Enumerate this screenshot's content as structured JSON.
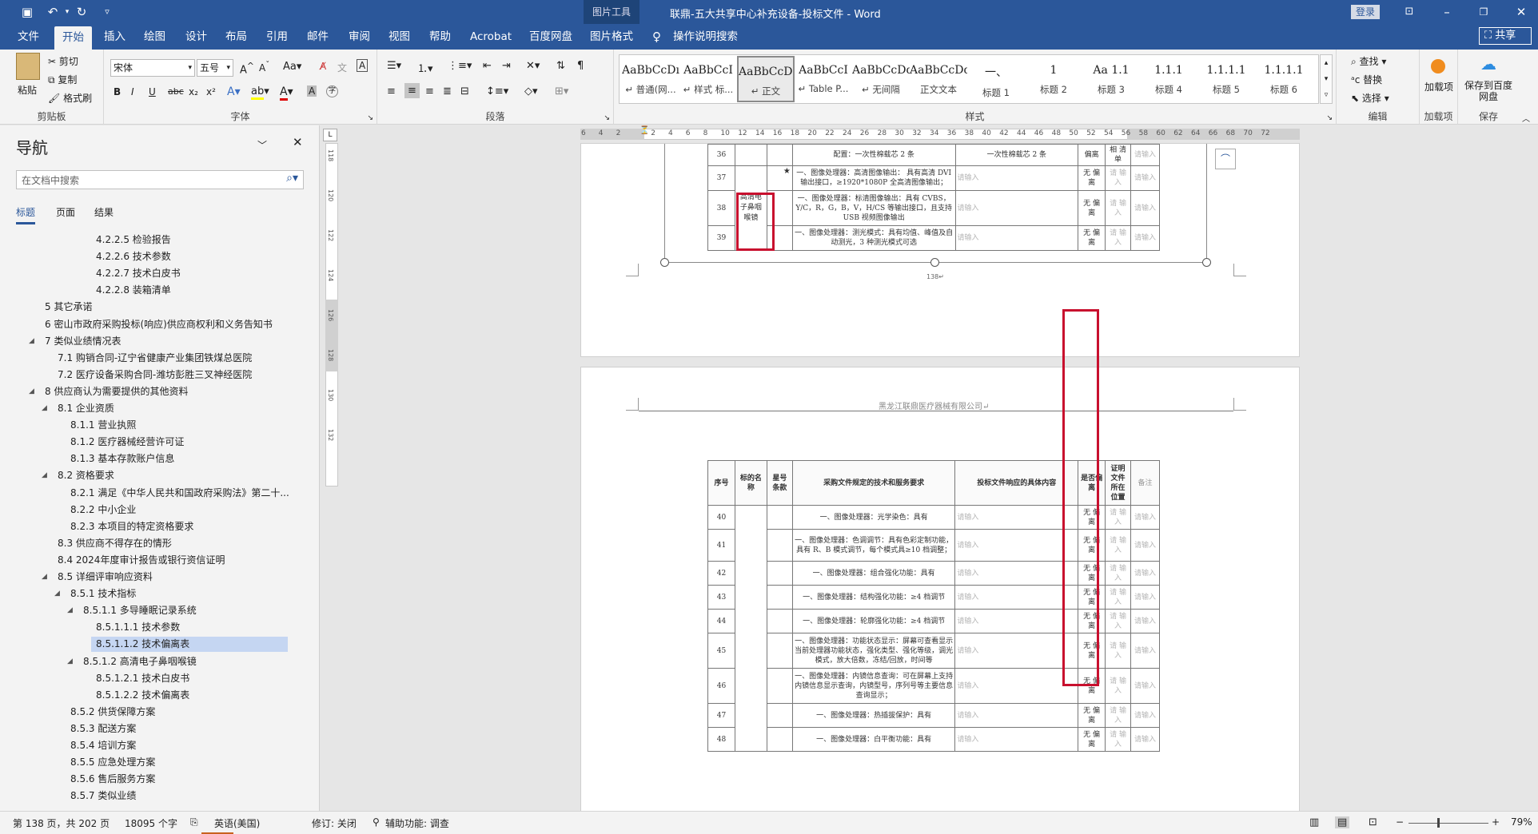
{
  "app": {
    "title": "联鼎-五大共享中心补充设备-投标文件 - Word",
    "context_tool": "图片工具",
    "login": "登录"
  },
  "menu": {
    "items": [
      "文件",
      "开始",
      "插入",
      "绘图",
      "设计",
      "布局",
      "引用",
      "邮件",
      "审阅",
      "视图",
      "帮助",
      "Acrobat",
      "百度网盘",
      "图片格式"
    ],
    "tell": "操作说明搜索",
    "share": "共享"
  },
  "ribbon": {
    "clipboard": {
      "paste": "粘贴",
      "cut": "剪切",
      "copy": "复制",
      "format_painter": "格式刷",
      "label": "剪贴板"
    },
    "font": {
      "name": "宋体",
      "size": "五号",
      "label": "字体",
      "bold": "B",
      "italic": "I",
      "underline": "U",
      "strike": "abc",
      "sub": "x₂",
      "sup": "x²"
    },
    "paragraph": {
      "label": "段落"
    },
    "styles": {
      "label": "样式",
      "cards": [
        {
          "preview": "AaBbCcDı",
          "name": "↵ 普通(网..."
        },
        {
          "preview": "AaBbCcI",
          "name": "↵ 样式 标..."
        },
        {
          "preview": "AaBbCcDdI",
          "name": "↵ 正文"
        },
        {
          "preview": "AaBbCcI",
          "name": "↵ Table P..."
        },
        {
          "preview": "AaBbCcDdI",
          "name": "↵ 无间隔"
        },
        {
          "preview": "AaBbCcDdI",
          "name": "正文文本"
        },
        {
          "preview": "一、",
          "name": "标题 1"
        },
        {
          "preview": "1",
          "name": "标题 2"
        },
        {
          "preview": "Aa 1.1",
          "name": "标题 3"
        },
        {
          "preview": "1.1.1",
          "name": "标题 4"
        },
        {
          "preview": "1.1.1.1",
          "name": "标题 5"
        },
        {
          "preview": "1.1.1.1",
          "name": "标题 6"
        }
      ]
    },
    "editing": {
      "find": "查找",
      "replace": "替换",
      "select": "选择",
      "label": "编辑"
    },
    "addins": {
      "load": "加载项",
      "label": "加载项"
    },
    "save": {
      "button": "保存到百度网盘",
      "label": "保存"
    }
  },
  "nav": {
    "title": "导航",
    "search_placeholder": "在文档中搜索",
    "tabs": [
      "标题",
      "页面",
      "结果"
    ],
    "items": [
      {
        "text": "4.2.2.5 检验报告",
        "level": 4,
        "tri": ""
      },
      {
        "text": "4.2.2.6 技术参数",
        "level": 4,
        "tri": ""
      },
      {
        "text": "4.2.2.7 技术白皮书",
        "level": 4,
        "tri": ""
      },
      {
        "text": "4.2.2.8 装箱清单",
        "level": 4,
        "tri": ""
      },
      {
        "text": "5 其它承诺",
        "level": 0,
        "tri": ""
      },
      {
        "text": "6 密山市政府采购投标(响应)供应商权利和义务告知书",
        "level": 0,
        "tri": ""
      },
      {
        "text": "7 类似业绩情况表",
        "level": 0,
        "tri": "◢"
      },
      {
        "text": "7.1 购销合同-辽宁省健康产业集团铁煤总医院",
        "level": 1,
        "tri": ""
      },
      {
        "text": "7.2 医疗设备采购合同-潍坊彭胜三叉神经医院",
        "level": 1,
        "tri": ""
      },
      {
        "text": "8 供应商认为需要提供的其他资料",
        "level": 0,
        "tri": "◢"
      },
      {
        "text": "8.1 企业资质",
        "level": 1,
        "tri": "◢"
      },
      {
        "text": "8.1.1 营业执照",
        "level": 2,
        "tri": ""
      },
      {
        "text": "8.1.2 医疗器械经营许可证",
        "level": 2,
        "tri": ""
      },
      {
        "text": "8.1.3 基本存款账户信息",
        "level": 2,
        "tri": ""
      },
      {
        "text": "8.2 资格要求",
        "level": 1,
        "tri": "◢"
      },
      {
        "text": "8.2.1 满足《中华人民共和国政府采购法》第二十...",
        "level": 2,
        "tri": ""
      },
      {
        "text": "8.2.2 中小企业",
        "level": 2,
        "tri": ""
      },
      {
        "text": "8.2.3 本项目的特定资格要求",
        "level": 2,
        "tri": ""
      },
      {
        "text": "8.3 供应商不得存在的情形",
        "level": 1,
        "tri": ""
      },
      {
        "text": "8.4 2024年度审计报告或银行资信证明",
        "level": 1,
        "tri": ""
      },
      {
        "text": "8.5 详细评审响应资料",
        "level": 1,
        "tri": "◢"
      },
      {
        "text": "8.5.1 技术指标",
        "level": 2,
        "tri": "◢"
      },
      {
        "text": "8.5.1.1 多导睡眠记录系统",
        "level": 3,
        "tri": "◢"
      },
      {
        "text": "8.5.1.1.1 技术参数",
        "level": 4,
        "tri": ""
      },
      {
        "text": "8.5.1.1.2 技术偏离表",
        "level": 4,
        "tri": "",
        "selected": true
      },
      {
        "text": "8.5.1.2 高清电子鼻咽喉镜",
        "level": 3,
        "tri": "◢"
      },
      {
        "text": "8.5.1.2.1 技术白皮书",
        "level": 4,
        "tri": ""
      },
      {
        "text": "8.5.1.2.2 技术偏离表",
        "level": 4,
        "tri": ""
      },
      {
        "text": "8.5.2 供货保障方案",
        "level": 2,
        "tri": ""
      },
      {
        "text": "8.5.3 配送方案",
        "level": 2,
        "tri": ""
      },
      {
        "text": "8.5.4 培训方案",
        "level": 2,
        "tri": ""
      },
      {
        "text": "8.5.5 应急处理方案",
        "level": 2,
        "tri": ""
      },
      {
        "text": "8.5.6 售后服务方案",
        "level": 2,
        "tri": ""
      },
      {
        "text": "8.5.7 类似业绩",
        "level": 2,
        "tri": ""
      }
    ]
  },
  "ruler": {
    "top": [
      "6",
      "4",
      "2",
      "",
      "2",
      "4",
      "6",
      "8",
      "10",
      "12",
      "14",
      "16",
      "18",
      "20",
      "22",
      "24",
      "26",
      "28",
      "30",
      "32",
      "34",
      "36",
      "38",
      "40",
      "42",
      "44",
      "46",
      "48",
      "50",
      "52",
      "54",
      "56",
      "58",
      "60",
      "62",
      "64",
      "66",
      "68",
      "70",
      "72"
    ],
    "left": [
      "118",
      "120",
      "122",
      "124",
      "126",
      "128",
      "130",
      "132"
    ]
  },
  "page1": {
    "row36": {
      "no": "36",
      "req": "配置：一次性棉载芯 2 条",
      "resp": "一次性棉载芯 2 条",
      "dev": "偏离",
      "proof": "相 清单"
    },
    "rows": [
      {
        "no": "37",
        "star": "★",
        "req": "一、图像处理器：高清图像输出： 具有高清 DVI 输出接口，≥1920*1080P 全高清图像输出；",
        "resp": "请输入",
        "dev": "无 偏 离",
        "proof": "请 输 入",
        "note": "请输入"
      },
      {
        "no": "38",
        "name": "高清电子鼻咽喉镜",
        "star": "",
        "req": "一、图像处理器：标清图像输出：具有 CVBS，Y/C，R，G，B，V，H/CS 等输出接口，且支持 USB 视频图像输出",
        "resp": "请输入",
        "dev": "无 偏 离",
        "proof": "请 输 入",
        "note": "请输入"
      },
      {
        "no": "39",
        "star": "",
        "req": "一、图像处理器：测光模式：具有均值、峰值及自动测光，3 种测光模式可选",
        "resp": "请输入",
        "dev": "无 偏 离",
        "proof": "请 输 入",
        "note": "请输入"
      }
    ],
    "page_number": "138↵"
  },
  "page2": {
    "header": "黑龙江联鼎医疗器械有限公司↵",
    "columns": [
      "序号",
      "标的名称",
      "星号条款",
      "采购文件规定的技术和服务要求",
      "投标文件响应的具体内容",
      "是否偏离",
      "证明文件所在位置",
      "备注"
    ],
    "rows": [
      {
        "no": "40",
        "req": "一、图像处理器：光学染色：具有",
        "resp": "请输入",
        "dev": "无 偏 离",
        "proof": "请 输 入",
        "note": "请输入"
      },
      {
        "no": "41",
        "req": "一、图像处理器：色调调节：具有色彩定制功能，具有 R、B 模式调节，每个模式具≥10 档调整；",
        "resp": "请输入",
        "dev": "无 偏 离",
        "proof": "请 输 入",
        "note": "请输入"
      },
      {
        "no": "42",
        "req": "一、图像处理器：组合强化功能：具有",
        "resp": "请输入",
        "dev": "无 偏 离",
        "proof": "请 输 入",
        "note": "请输入"
      },
      {
        "no": "43",
        "req": "一、图像处理器：结构强化功能：≥4 档调节",
        "resp": "请输入",
        "dev": "无 偏 离",
        "proof": "请 输 入",
        "note": "请输入"
      },
      {
        "no": "44",
        "req": "一、图像处理器：轮廓强化功能：≥4 档调节",
        "resp": "请输入",
        "dev": "无 偏 离",
        "proof": "请 输 入",
        "note": "请输入"
      },
      {
        "no": "45",
        "req": "一、图像处理器：功能状态显示：屏幕可查看显示当前处理器功能状态，强化类型、强化等级，调光模式，放大倍数，冻结/回放，时间等",
        "resp": "请输入",
        "dev": "无 偏 离",
        "proof": "请 输 入",
        "note": "请输入"
      },
      {
        "no": "46",
        "req": "一、图像处理器：内镜信息查询：可在屏幕上支持内镜信息显示查询，内镜型号，序列号等主要信息查询显示；",
        "resp": "请输入",
        "dev": "无 偏 离",
        "proof": "请 输 入",
        "note": "请输入"
      },
      {
        "no": "47",
        "req": "一、图像处理器：热插拔保护：具有",
        "resp": "请输入",
        "dev": "无 偏 离",
        "proof": "请 输 入",
        "note": "请输入"
      },
      {
        "no": "48",
        "req": "一、图像处理器：白平衡功能：具有",
        "resp": "请输入",
        "dev": "无 偏 离",
        "proof": "请 输 入",
        "note": "请输入"
      }
    ]
  },
  "status": {
    "page": "第 138 页，共 202 页",
    "words": "18095 个字",
    "lang": "英语(美国)",
    "track": "修订: 关闭",
    "access": "辅助功能: 调查",
    "zoom": "79%"
  },
  "colors": {
    "brand": "#2b579a",
    "highlight_box": "#c8102e",
    "nav_selected": "#c5d6f2"
  }
}
